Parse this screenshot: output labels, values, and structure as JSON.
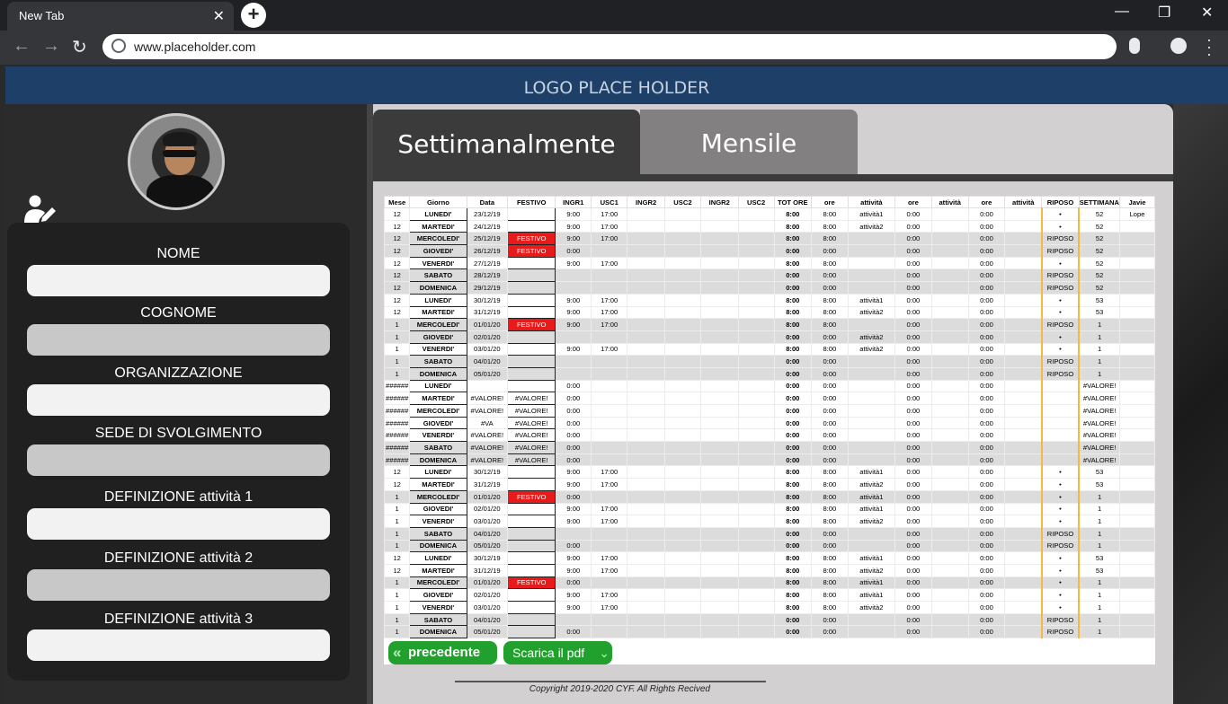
{
  "browser": {
    "tab_title": "New Tab",
    "tab_close": "✕",
    "new_tab": "+",
    "url": "www.placeholder.com",
    "win_min": "—",
    "win_restore": "❐",
    "win_close": "✕"
  },
  "header": {
    "logo_text": "LOGO PLACE HOLDER"
  },
  "form": {
    "fields": [
      {
        "label": "NOME",
        "value": ""
      },
      {
        "label": "COGNOME",
        "value": ""
      },
      {
        "label": "ORGANIZZAZIONE",
        "value": ""
      },
      {
        "label": "SEDE DI SVOLGIMENTO",
        "value": ""
      },
      {
        "label": "DEFINIZIONE attività 1",
        "value": ""
      },
      {
        "label": "DEFINIZIONE attività 2",
        "value": ""
      },
      {
        "label": "DEFINIZIONE attività 3",
        "value": ""
      }
    ]
  },
  "tabs": {
    "weekly": "Settimanalmente",
    "monthly": "Mensile"
  },
  "sheet": {
    "headers": [
      "Mese",
      "Giorno",
      "Data",
      "FESTIVO",
      "INGR1",
      "USC1",
      "INGR2",
      "USC2",
      "INGR2",
      "USC2",
      "TOT ORE",
      "ore",
      "attività",
      "ore",
      "attività",
      "ore",
      "attività",
      "RIPOSO",
      "SETTIMANA",
      "Javie"
    ],
    "rows": [
      [
        "12",
        "LUNEDI'",
        "23/12/19",
        "",
        "9:00",
        "17:00",
        "",
        "",
        "",
        "",
        "8:00",
        "8:00",
        "attività1",
        "0:00",
        "",
        "0:00",
        "",
        "•",
        "52",
        "Lope"
      ],
      [
        "12",
        "MARTEDI'",
        "24/12/19",
        "",
        "9:00",
        "17:00",
        "",
        "",
        "",
        "",
        "8:00",
        "8:00",
        "attività2",
        "0:00",
        "",
        "0:00",
        "",
        "•",
        "52",
        ""
      ],
      [
        "12",
        "MERCOLEDI'",
        "25/12/19",
        "FESTIVO",
        "9:00",
        "17:00",
        "",
        "",
        "",
        "",
        "8:00",
        "8:00",
        "",
        "0:00",
        "",
        "0:00",
        "",
        "RIPOSO",
        "52",
        ""
      ],
      [
        "12",
        "GIOVEDI'",
        "26/12/19",
        "FESTIVO",
        "0:00",
        "",
        "",
        "",
        "",
        "",
        "0:00",
        "0:00",
        "",
        "0:00",
        "",
        "0:00",
        "",
        "RIPOSO",
        "52",
        ""
      ],
      [
        "12",
        "VENERDI'",
        "27/12/19",
        "",
        "9:00",
        "17:00",
        "",
        "",
        "",
        "",
        "8:00",
        "8:00",
        "",
        "0:00",
        "",
        "0:00",
        "",
        "•",
        "52",
        ""
      ],
      [
        "12",
        "SABATO",
        "28/12/19",
        "",
        "",
        "",
        "",
        "",
        "",
        "",
        "0:00",
        "0:00",
        "",
        "0:00",
        "",
        "0:00",
        "",
        "RIPOSO",
        "52",
        ""
      ],
      [
        "12",
        "DOMENICA",
        "29/12/19",
        "",
        "",
        "",
        "",
        "",
        "",
        "",
        "0:00",
        "0:00",
        "",
        "0:00",
        "",
        "0:00",
        "",
        "RIPOSO",
        "52",
        ""
      ],
      [
        "12",
        "LUNEDI'",
        "30/12/19",
        "",
        "9:00",
        "17:00",
        "",
        "",
        "",
        "",
        "8:00",
        "8:00",
        "attività1",
        "0:00",
        "",
        "0:00",
        "",
        "•",
        "53",
        ""
      ],
      [
        "12",
        "MARTEDI'",
        "31/12/19",
        "",
        "9:00",
        "17:00",
        "",
        "",
        "",
        "",
        "8:00",
        "8:00",
        "attività2",
        "0:00",
        "",
        "0:00",
        "",
        "•",
        "53",
        ""
      ],
      [
        "1",
        "MERCOLEDI'",
        "01/01/20",
        "FESTIVO",
        "9:00",
        "17:00",
        "",
        "",
        "",
        "",
        "8:00",
        "8:00",
        "",
        "0:00",
        "",
        "0:00",
        "",
        "RIPOSO",
        "1",
        ""
      ],
      [
        "1",
        "GIOVEDI'",
        "02/01/20",
        "",
        "",
        "",
        "",
        "",
        "",
        "",
        "0:00",
        "0:00",
        "attività2",
        "0:00",
        "",
        "0:00",
        "",
        "•",
        "1",
        ""
      ],
      [
        "1",
        "VENERDI'",
        "03/01/20",
        "",
        "9:00",
        "17:00",
        "",
        "",
        "",
        "",
        "8:00",
        "8:00",
        "attività2",
        "0:00",
        "",
        "0:00",
        "",
        "•",
        "1",
        ""
      ],
      [
        "1",
        "SABATO",
        "04/01/20",
        "",
        "",
        "",
        "",
        "",
        "",
        "",
        "0:00",
        "0:00",
        "",
        "0:00",
        "",
        "0:00",
        "",
        "RIPOSO",
        "1",
        ""
      ],
      [
        "1",
        "DOMENICA",
        "05/01/20",
        "",
        "",
        "",
        "",
        "",
        "",
        "",
        "0:00",
        "0:00",
        "",
        "0:00",
        "",
        "0:00",
        "",
        "RIPOSO",
        "1",
        ""
      ],
      [
        "######",
        "LUNEDI'",
        "",
        "",
        "0:00",
        "",
        "",
        "",
        "",
        "",
        "0:00",
        "0:00",
        "",
        "0:00",
        "",
        "0:00",
        "",
        "",
        "#VALORE!",
        ""
      ],
      [
        "######",
        "MARTEDI'",
        "#VALORE!",
        "#VALORE!",
        "0:00",
        "",
        "",
        "",
        "",
        "",
        "0:00",
        "0:00",
        "",
        "0:00",
        "",
        "0:00",
        "",
        "",
        "#VALORE!",
        ""
      ],
      [
        "######",
        "MERCOLEDI'",
        "#VALORE!",
        "#VALORE!",
        "0:00",
        "",
        "",
        "",
        "",
        "",
        "0:00",
        "0:00",
        "",
        "0:00",
        "",
        "0:00",
        "",
        "",
        "#VALORE!",
        ""
      ],
      [
        "######",
        "GIOVEDI'",
        "#VA",
        "#VALORE!",
        "0:00",
        "",
        "",
        "",
        "",
        "",
        "0:00",
        "0:00",
        "",
        "0:00",
        "",
        "0:00",
        "",
        "",
        "#VALORE!",
        ""
      ],
      [
        "######",
        "VENERDI'",
        "#VALORE!",
        "#VALORE!",
        "0:00",
        "",
        "",
        "",
        "",
        "",
        "0:00",
        "0:00",
        "",
        "0:00",
        "",
        "0:00",
        "",
        "",
        "#VALORE!",
        ""
      ],
      [
        "######",
        "SABATO",
        "#VALORE!",
        "#VALORE!",
        "0:00",
        "",
        "",
        "",
        "",
        "",
        "0:00",
        "0:00",
        "",
        "0:00",
        "",
        "0:00",
        "",
        "",
        "#VALORE!",
        ""
      ],
      [
        "######",
        "DOMENICA",
        "#VALORE!",
        "#VALORE!",
        "0:00",
        "",
        "",
        "",
        "",
        "",
        "0:00",
        "0:00",
        "",
        "0:00",
        "",
        "0:00",
        "",
        "",
        "#VALORE!",
        ""
      ],
      [
        "12",
        "LUNEDI'",
        "30/12/19",
        "",
        "9:00",
        "17:00",
        "",
        "",
        "",
        "",
        "8:00",
        "8:00",
        "attività1",
        "0:00",
        "",
        "0:00",
        "",
        "•",
        "53",
        ""
      ],
      [
        "12",
        "MARTEDI'",
        "31/12/19",
        "",
        "9:00",
        "17:00",
        "",
        "",
        "",
        "",
        "8:00",
        "8:00",
        "attività2",
        "0:00",
        "",
        "0:00",
        "",
        "•",
        "53",
        ""
      ],
      [
        "1",
        "MERCOLEDI'",
        "01/01/20",
        "FESTIVO",
        "0:00",
        "",
        "",
        "",
        "",
        "",
        "8:00",
        "8:00",
        "attività1",
        "0:00",
        "",
        "0:00",
        "",
        "•",
        "1",
        ""
      ],
      [
        "1",
        "GIOVEDI'",
        "02/01/20",
        "",
        "9:00",
        "17:00",
        "",
        "",
        "",
        "",
        "8:00",
        "8:00",
        "attività1",
        "0:00",
        "",
        "0:00",
        "",
        "•",
        "1",
        ""
      ],
      [
        "1",
        "VENERDI'",
        "03/01/20",
        "",
        "9:00",
        "17:00",
        "",
        "",
        "",
        "",
        "8:00",
        "8:00",
        "attività2",
        "0:00",
        "",
        "0:00",
        "",
        "•",
        "1",
        ""
      ],
      [
        "1",
        "SABATO",
        "04/01/20",
        "",
        "",
        "",
        "",
        "",
        "",
        "",
        "0:00",
        "0:00",
        "",
        "0:00",
        "",
        "0:00",
        "",
        "RIPOSO",
        "1",
        ""
      ],
      [
        "1",
        "DOMENICA",
        "05/01/20",
        "",
        "0:00",
        "",
        "",
        "",
        "",
        "",
        "0:00",
        "0:00",
        "",
        "0:00",
        "",
        "0:00",
        "",
        "RIPOSO",
        "1",
        ""
      ],
      [
        "12",
        "LUNEDI'",
        "30/12/19",
        "",
        "9:00",
        "17:00",
        "",
        "",
        "",
        "",
        "8:00",
        "8:00",
        "attività1",
        "0:00",
        "",
        "0:00",
        "",
        "•",
        "53",
        ""
      ],
      [
        "12",
        "MARTEDI'",
        "31/12/19",
        "",
        "9:00",
        "17:00",
        "",
        "",
        "",
        "",
        "8:00",
        "8:00",
        "attività2",
        "0:00",
        "",
        "0:00",
        "",
        "•",
        "53",
        ""
      ],
      [
        "1",
        "MERCOLEDI'",
        "01/01/20",
        "FESTIVO",
        "0:00",
        "",
        "",
        "",
        "",
        "",
        "8:00",
        "8:00",
        "attività1",
        "0:00",
        "",
        "0:00",
        "",
        "•",
        "1",
        ""
      ],
      [
        "1",
        "GIOVEDI'",
        "02/01/20",
        "",
        "9:00",
        "17:00",
        "",
        "",
        "",
        "",
        "8:00",
        "8:00",
        "attività1",
        "0:00",
        "",
        "0:00",
        "",
        "•",
        "1",
        ""
      ],
      [
        "1",
        "VENERDI'",
        "03/01/20",
        "",
        "9:00",
        "17:00",
        "",
        "",
        "",
        "",
        "8:00",
        "8:00",
        "attività2",
        "0:00",
        "",
        "0:00",
        "",
        "•",
        "1",
        ""
      ],
      [
        "1",
        "SABATO",
        "04/01/20",
        "",
        "",
        "",
        "",
        "",
        "",
        "",
        "0:00",
        "0:00",
        "",
        "0:00",
        "",
        "0:00",
        "",
        "RIPOSO",
        "1",
        ""
      ],
      [
        "1",
        "DOMENICA",
        "05/01/20",
        "",
        "0:00",
        "",
        "",
        "",
        "",
        "",
        "0:00",
        "0:00",
        "",
        "0:00",
        "",
        "0:00",
        "",
        "RIPOSO",
        "1",
        ""
      ]
    ]
  },
  "buttons": {
    "prev": "precedente",
    "pdf": "Scarica il pdf"
  },
  "footer": {
    "copyright": "Copyright 2019-2020 CYF. All Rights Recived"
  }
}
